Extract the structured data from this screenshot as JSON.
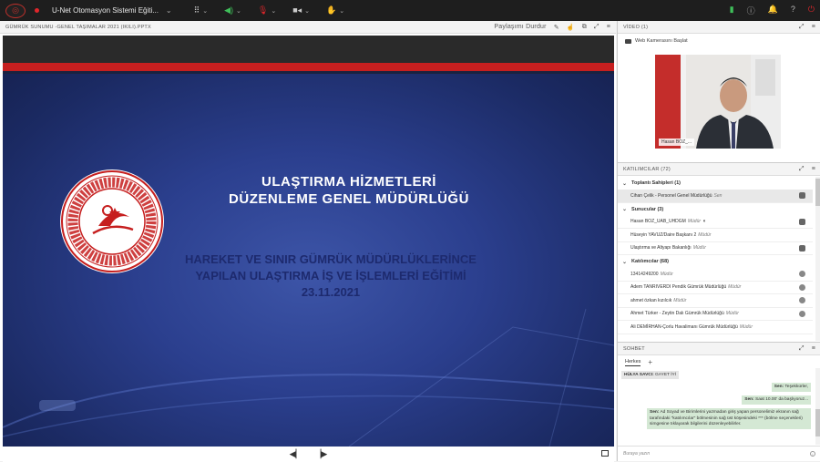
{
  "topbar": {
    "title": "U-Net Otomasyon Sistemi Eğiti...",
    "icons": [
      "apps-icon",
      "speaker-icon",
      "mic-icon",
      "camera-icon",
      "raise-hand-icon"
    ],
    "right_icons": [
      "signal-icon",
      "info-icon",
      "bell-icon",
      "help-icon",
      "power-icon"
    ]
  },
  "share": {
    "header": "GÜMRÜK SUNUMU -GENEL TAŞIMALAR 2021 (IKILI).PPTX",
    "stop_label": "Paylaşımı Durdur",
    "slide": {
      "title_line1": "ULAŞTIRMA HİZMETLERİ",
      "title_line2": "DÜZENLEME GENEL MÜDÜRLÜĞÜ",
      "sub_line1": "HAREKET VE SINIR GÜMRÜK MÜDÜRLÜKLERİNCE",
      "sub_line2": "YAPILAN ULAŞTIRMA İŞ VE İŞLEMLERİ EĞİTİMİ",
      "sub_line3": "23.11.2021",
      "seal_text": "TÜRKİYE CUMHURİYETİ ULAŞTIRMA VE ALTYAPI BAKANLIĞI"
    }
  },
  "video": {
    "header": "VİDEO (1)",
    "webcam_label": "Web Kamerasını Başlat",
    "presenter_name": "Hasan BOZ_..."
  },
  "attendees": {
    "header": "KATILIMCILAR (72)",
    "hosts_label": "Toplantı Sahipleri (1)",
    "hosts": [
      {
        "name": "Cihan Çelik - Personel Genel Müdürlüğü",
        "role": "Sen"
      }
    ],
    "presenters_label": "Sunucular (3)",
    "presenters": [
      {
        "name": "Hasan BOZ_UAB_UHDGM",
        "role": "Müdür"
      },
      {
        "name": "Hüseyin YAVUZ/Daire Başkanı 2",
        "role": "Müdür"
      },
      {
        "name": "Ulaştırma ve Altyapı Bakanlığı",
        "role": "Müdür"
      }
    ],
    "participants_label": "Katılımcılar (68)",
    "participants": [
      {
        "name": "13414249200",
        "role": "Müdür"
      },
      {
        "name": "Adem TANRIVERDI Pendik Gümrük Müdürlüğü",
        "role": "Müdür"
      },
      {
        "name": "ahmet özkan kızılcık",
        "role": "Müdür"
      },
      {
        "name": "Ahmet Türker - Zeytin Dalı Gümrük Müdürlüğü",
        "role": "Müdür"
      },
      {
        "name": "Ali DEMİRHAN-Çorlu Havalimanı Gümrük Müdürlüğü",
        "role": "Müdür"
      }
    ]
  },
  "chat": {
    "header": "SOHBET",
    "tab": "Herkes",
    "messages_in": [
      {
        "from": "HÜLYA SAVCI:",
        "text": "GAYET İYİ"
      }
    ],
    "messages_out": [
      {
        "from": "Sen:",
        "text": "Teşekkürler,"
      },
      {
        "from": "Sen:",
        "text": "Saat 10.00' da başlıyoruz..."
      },
      {
        "from": "Sen:",
        "text": "Ad Soyad ve Birimlerini yazmadan giriş yapan personelimiz ekranın sağ tarafındaki \"katılımcılar\" bölmesinin sağ üst köşesindeki *** (bölme seçenekleri) simgesine tıklayarak bilgilerini düzenleyebilirler."
      }
    ],
    "placeholder": "Buraya yazın"
  },
  "colors": {
    "slide_bg": "#2b3f8e",
    "stripe": "#c61f1f",
    "subtitle": "#1d2a6e",
    "chat_out": "#d4e8d4"
  }
}
